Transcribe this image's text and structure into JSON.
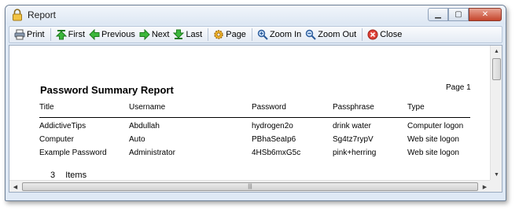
{
  "window": {
    "title": "Report"
  },
  "toolbar": {
    "print": "Print",
    "first": "First",
    "previous": "Previous",
    "next": "Next",
    "last": "Last",
    "page": "Page",
    "zoom_in": "Zoom In",
    "zoom_out": "Zoom Out",
    "close": "Close"
  },
  "report": {
    "title": "Password Summary Report",
    "page_label": "Page 1",
    "columns": [
      "Title",
      "Username",
      "Password",
      "Passphrase",
      "Type"
    ],
    "rows": [
      [
        "AddictiveTips",
        "Abdullah",
        "hydrogen2o",
        "drink water",
        "Computer logon"
      ],
      [
        "Computer",
        "Auto",
        "PBhaSeaIp6",
        "Sg4tz7rypV",
        "Web site logon"
      ],
      [
        "Example Password",
        "Administrator",
        "4HSb6mxG5c",
        "pink+herring",
        "Web site logon"
      ]
    ],
    "item_count": "3",
    "items_label": "Items"
  }
}
